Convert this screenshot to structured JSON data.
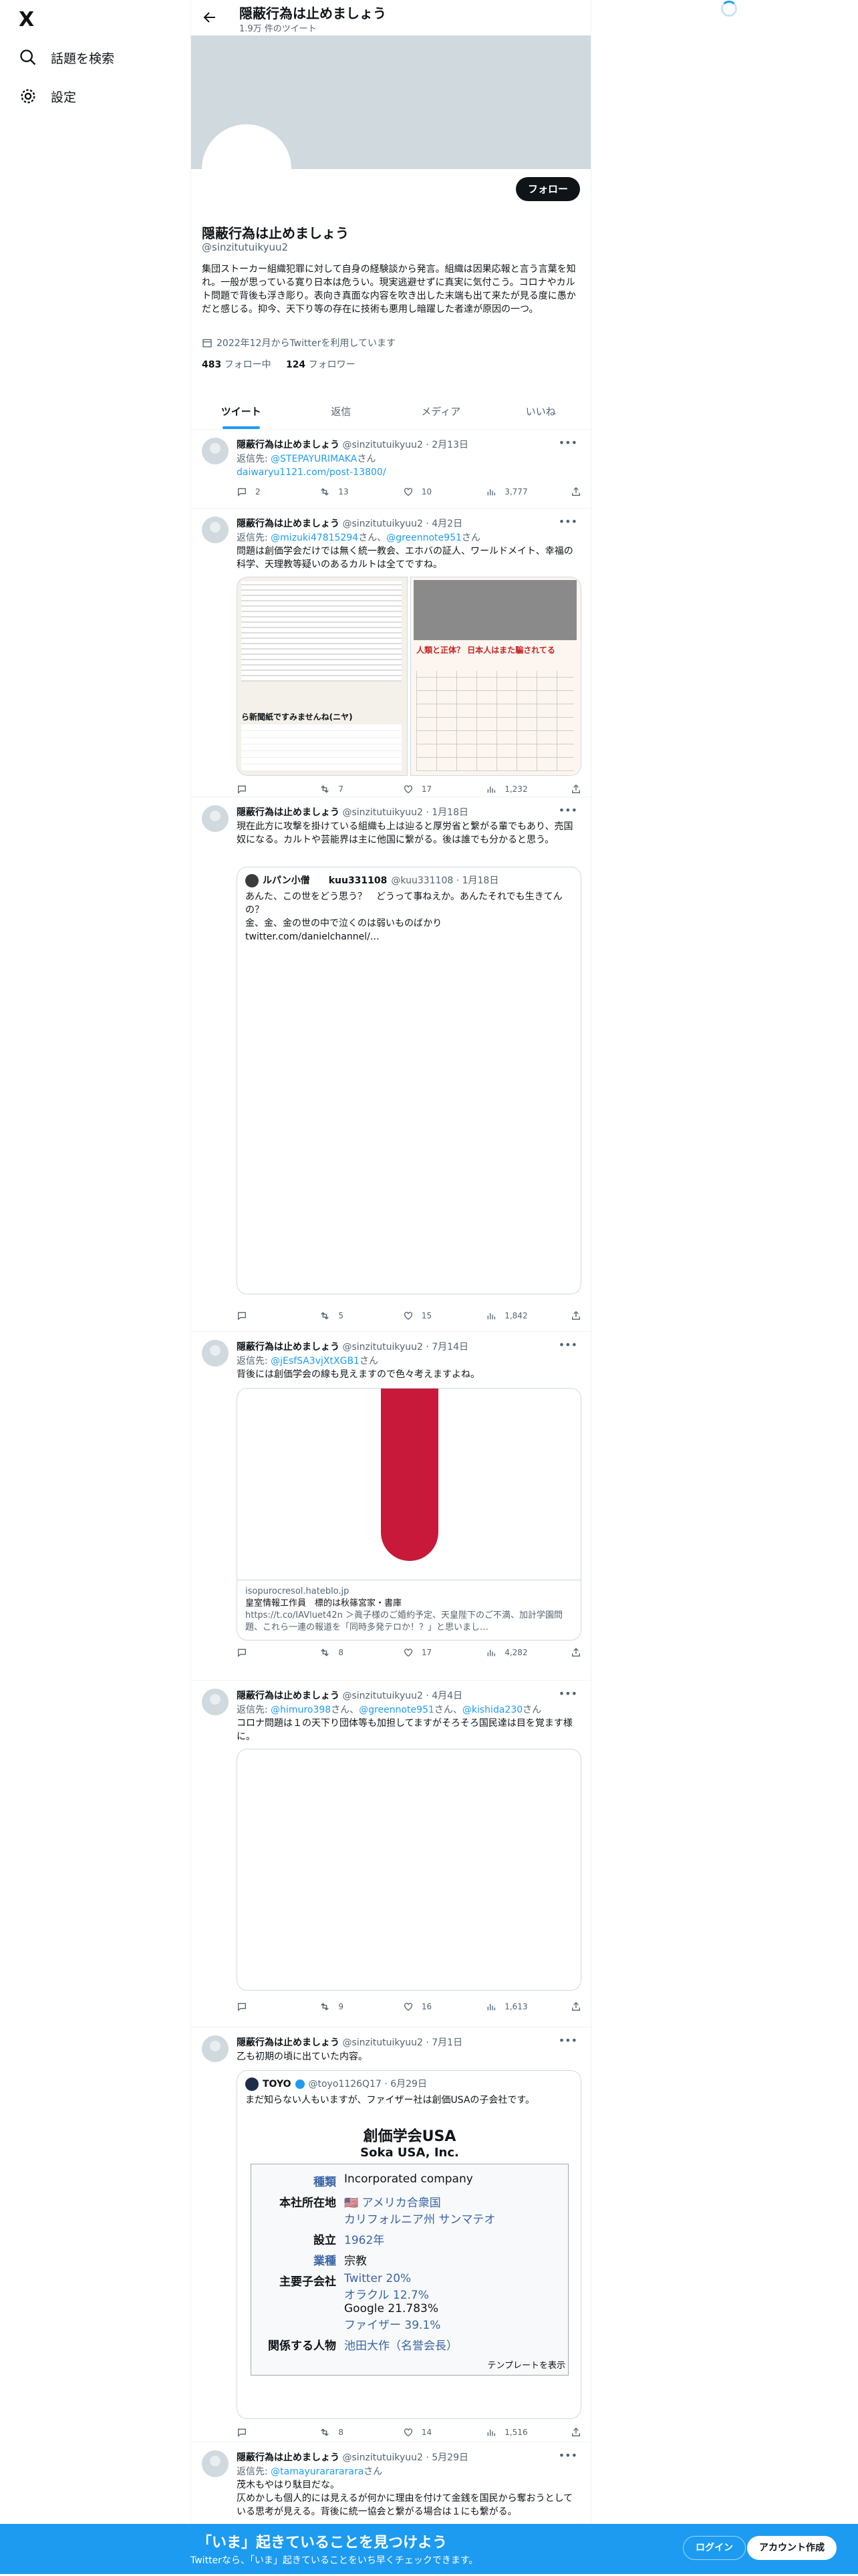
{
  "nav": {
    "logo": "X",
    "explore_label": "話題を検索",
    "settings_label": "設定"
  },
  "header": {
    "name": "隠蔽行為は止めましょう",
    "tweet_count": "1.9万 件のツイート"
  },
  "profile": {
    "follow_label": "フォロー",
    "name": "隠蔽行為は止めましょう",
    "handle": "@sinzitutuikyuu2",
    "bio": "集団ストーカー組織犯罪に対して自身の経験談から発言。組織は因果応報と言う言葉を知れ。一般が思っている寛り日本は危うい。現実逃避せずに真実に気付こう。コロナやカルト問題で背後も浮き彫り。表向き真面な内容を吹き出した末端も出て来たが見る度に愚かだと感じる。抑今、天下り等の存在に技術も悪用し暗躍した者達が原因の一つ。",
    "joined": "2022年12月からTwitterを利用しています",
    "following_count": "483",
    "following_label": "フォロー中",
    "followers_count": "124",
    "followers_label": "フォロワー"
  },
  "tabs": [
    "ツイート",
    "返信",
    "メディア",
    "いいね"
  ],
  "tweets": [
    {
      "name": "隠蔽行為は止めましょう",
      "handle": "@sinzitutuikyuu2",
      "date": "· 2月13日",
      "reply_prefix": "返信先: ",
      "reply_to": "@STEPAYURIMAKA",
      "reply_suffix": "さん",
      "link": "daiwaryu1121.com/post-13800/",
      "replies": "2",
      "retweets": "13",
      "likes": "10",
      "views": "3,777"
    },
    {
      "name": "隠蔽行為は止めましょう",
      "handle": "@sinzitutuikyuu2",
      "date": "· 4月2日",
      "reply_prefix": "返信先: ",
      "reply_to": "@mizuki47815294",
      "reply_mid": "さん、",
      "reply_to2": "@greennote951",
      "reply_suffix": "さん",
      "text": "問題は創価学会だけでは無く統一教会、エホバの証人、ワールドメイト、幸福の科学、天理教等疑いのあるカルトは全てですね。",
      "img_caption1": "ら新聞紙ですみませんね(ニヤ)",
      "img_caption2": "人類と正体？ 日本人はまた騙されてる",
      "replies": "",
      "retweets": "7",
      "likes": "17",
      "views": "1,232"
    },
    {
      "name": "隠蔽行為は止めましょう",
      "handle": "@sinzitutuikyuu2",
      "date": "· 1月18日",
      "text": "現在此方に攻撃を掛けている組織も上は辿ると厚労省と繋がる輩でもあり、売国奴になる。カルトや芸能界は主に他国に繋がる。後は誰でも分かると思う。",
      "quote_name": "ルパン小僧　　kuu331108",
      "quote_handle": "@kuu331108 · 1月18日",
      "quote_text": "あんた、この世をどう思う？　どうって事ねえか。あんたそれでも生きてんの？\n金、金、金の世の中で泣くのは弱いものばかり\ntwitter.com/danielchannel/…",
      "replies": "",
      "retweets": "5",
      "likes": "15",
      "views": "1,842"
    },
    {
      "name": "隠蔽行為は止めましょう",
      "handle": "@sinzitutuikyuu2",
      "date": "· 7月14日",
      "reply_prefix": "返信先: ",
      "reply_to": "@jEsfSA3vjXtXGB1",
      "reply_suffix": "さん",
      "text": "背後には創価学会の線も見えますので色々考えますよね。",
      "card_domain": "isopurocresol.hateblo.jp",
      "card_title": "皇室情報工作員　標的は秋篠宮家・書庫",
      "card_desc": "https://t.co/IAVluet42n ＞眞子様のご婚約予定、天皇陛下のご不満、加計学園問題、これら一連の報道を「同時多発テロか！？」と思いまし…",
      "replies": "",
      "retweets": "8",
      "likes": "17",
      "views": "4,282"
    },
    {
      "name": "隠蔽行為は止めましょう",
      "handle": "@sinzitutuikyuu2",
      "date": "· 4月4日",
      "reply_prefix": "返信先: ",
      "reply_to": "@himuro398",
      "reply_mid": "さん、",
      "reply_to2": "@greennote951",
      "reply_mid2": "さん、",
      "reply_to3": "@kishida230",
      "reply_suffix": "さん",
      "text": "コロナ問題は１の天下り団体等も加担してますがそろそろ国民達は目を覚ます様に。",
      "replies": "",
      "retweets": "9",
      "likes": "16",
      "views": "1,613"
    },
    {
      "name": "隠蔽行為は止めましょう",
      "handle": "@sinzitutuikyuu2",
      "date": "· 7月1日",
      "text": "乙も初期の頃に出ていた内容。",
      "quote_name": "TOYO",
      "quote_handle": "@toyo1126Q17 · 6月29日",
      "quote_text": "まだ知らない人もいますが、ファイザー社は創価USAの子会社です。",
      "soka": {
        "title": "創価学会USA",
        "subtitle": "Soka USA, Inc.",
        "rows": [
          {
            "k": "種類",
            "v": "Incorporated company",
            "kcolor": true
          },
          {
            "k": "本社所在地",
            "v": "🇺🇸 アメリカ合衆国",
            "v2": "カリフォルニア州 サンマテオ"
          },
          {
            "k": "設立",
            "v": "1962年",
            "vlink": true
          },
          {
            "k": "業種",
            "v": "宗教",
            "kcolor": true
          },
          {
            "k": "主要子会社",
            "v": "Twitter 20%",
            "v2": "オラクル 12.7%",
            "v3": "Google 21.783%",
            "v4": "ファイザー 39.1%"
          },
          {
            "k": "関係する人物",
            "v": "池田大作（名誉会長）",
            "vlink": true
          }
        ],
        "template_link": "テンプレートを表示"
      },
      "replies": "",
      "retweets": "8",
      "likes": "14",
      "views": "1,516"
    },
    {
      "name": "隠蔽行為は止めましょう",
      "handle": "@sinzitutuikyuu2",
      "date": "· 5月29日",
      "reply_prefix": "返信先: ",
      "reply_to": "@tamayurarararara",
      "reply_suffix": "さん",
      "text": "茂木もやはり駄目だな。\n仄めかしも個人的には見えるが何かに理由を付けて金銭を国民から奪おうとしている思考が見える。背後に統一協会と繋がる場合は１にも繋がる。"
    }
  ],
  "bottom_bar": {
    "title": "「いま」起きていることを見つけよう",
    "subtitle": "Twitterなら、「いま」起きていることをいち早くチェックできます。",
    "login": "ログイン",
    "signup": "アカウント作成"
  },
  "colors": {
    "accent": "#1d9bf0",
    "text": "#0f1419",
    "muted": "#536471",
    "banner": "#cfd9de"
  }
}
